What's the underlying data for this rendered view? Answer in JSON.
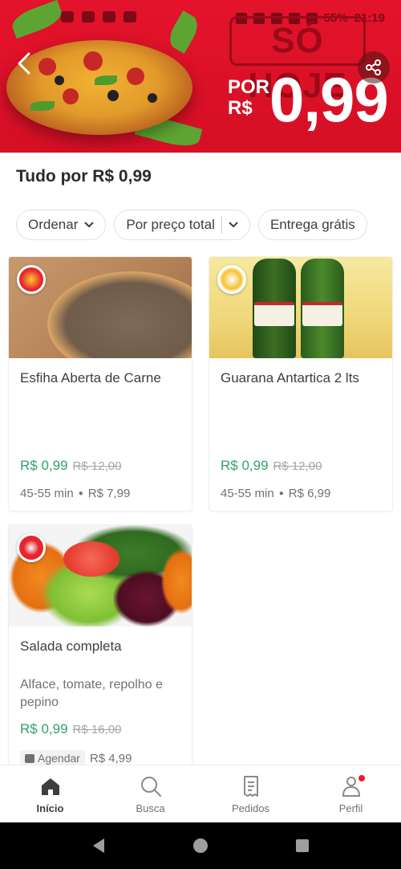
{
  "status_bar": {
    "battery": "55%",
    "time": "21:19"
  },
  "banner": {
    "headline": "SÓ HOJE",
    "price_prefix": "POR R$",
    "price": "0,99"
  },
  "page": {
    "title": "Tudo por R$ 0,99"
  },
  "filters": [
    {
      "label": "Ordenar"
    },
    {
      "label": "Por preço total"
    },
    {
      "label": "Entrega grátis"
    }
  ],
  "products": [
    {
      "name": "Esfiha Aberta de Carne",
      "description": "",
      "price": "R$ 0,99",
      "old_price": "R$ 12,00",
      "delivery_time": "45-55 min",
      "delivery_fee": "R$ 7,99"
    },
    {
      "name": "Guarana Antartica 2 lts",
      "description": "",
      "price": "R$ 0,99",
      "old_price": "R$ 12,00",
      "delivery_time": "45-55 min",
      "delivery_fee": "R$ 6,99"
    },
    {
      "name": "Salada completa",
      "description": "Alface, tomate, repolho e pepino",
      "price": "R$ 0,99",
      "old_price": "R$ 16,00",
      "schedule_label": "Agendar",
      "delivery_fee": "R$ 4,99"
    }
  ],
  "bottom_nav": [
    {
      "label": "Início",
      "icon": "home-icon",
      "active": true
    },
    {
      "label": "Busca",
      "icon": "search-icon"
    },
    {
      "label": "Pedidos",
      "icon": "orders-icon"
    },
    {
      "label": "Perfil",
      "icon": "profile-icon",
      "notification": true
    }
  ],
  "colors": {
    "brand_red": "#ea1d2c",
    "price_green": "#2fa36b",
    "banner_red": "#e3132b"
  }
}
